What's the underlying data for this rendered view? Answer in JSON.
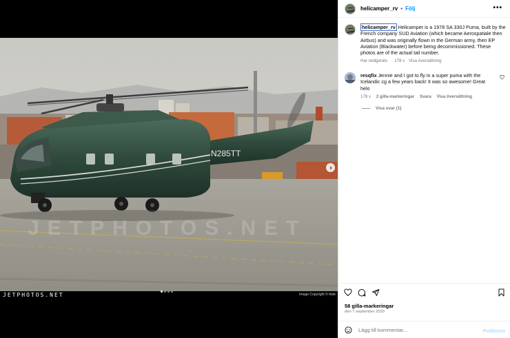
{
  "header": {
    "username": "helicamper_rv",
    "separator": "•",
    "follow_label": "Följ",
    "more_label": "•••"
  },
  "caption": {
    "username": "helicamper_rv",
    "text": "Helicamper is a 1978 SA 330J Puma, built by the French company SUD Aviation (which became Aerospatiale then Airbus) and was originally flown in the German army, then EP Aviation (Blackwater) before being decommissioned. These photos are of the actual tail number.",
    "edited": "Har redigerats",
    "sep": "·",
    "age": "178 v",
    "translate": "Visa översättning"
  },
  "comment": {
    "username": "resqfix",
    "text": "Jennie and I got to fly in a super puma with the Icelandic cg a few years back! It was so awesome! Great helo",
    "age": "178 v",
    "likes": "2 gilla-markeringar",
    "reply": "Svara",
    "translate": "Visa översättning",
    "view_replies": "Visa svar (1)"
  },
  "media": {
    "tail_number": "N285TT",
    "watermark": "JETPHOTOS.NET",
    "logo": "JETPHOTOS.NET",
    "copyright": "Image Copyright © fede",
    "slides": 4,
    "active_slide": 1
  },
  "footer": {
    "likes": "58 gilla-markeringar",
    "date": "den 7 september 2020",
    "comment_placeholder": "Lägg till kommentar...",
    "publish_label": "Publicera"
  },
  "colors": {
    "accent": "#0095f6",
    "publish_disabled": "#b3dbff",
    "helicopter_green": "#2f4a3c"
  },
  "icons": [
    "heart-icon",
    "comment-icon",
    "share-icon",
    "bookmark-icon",
    "emoji-icon",
    "chevron-right-icon",
    "more-icon"
  ]
}
